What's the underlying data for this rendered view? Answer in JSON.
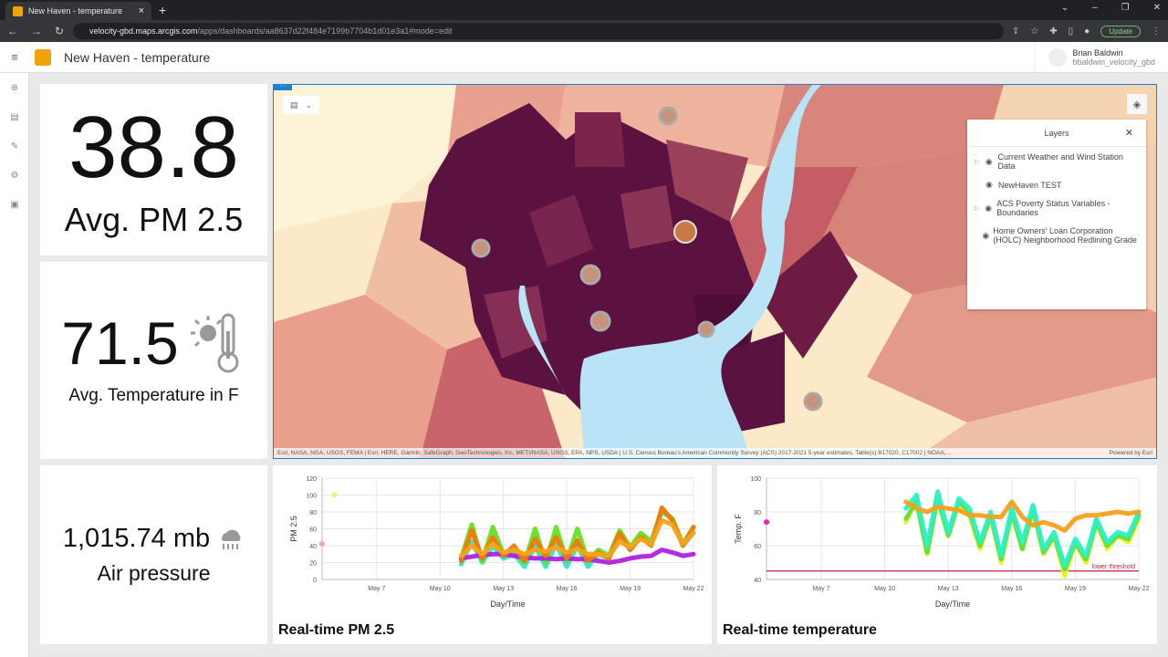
{
  "browser": {
    "tab_title": "New Haven - temperature",
    "url_host": "velocity-gbd.maps.arcgis.com",
    "url_path": "/apps/dashboards/aa8637d22f484e7199b7704b1d01e3a1#mode=edit",
    "update_label": "Update"
  },
  "app": {
    "title": "New Haven - temperature",
    "user_name": "Brian Baldwin",
    "user_handle": "bbaldwin_velocity_gbd"
  },
  "indicators": [
    {
      "value": "38.8",
      "label": "Avg. PM 2.5"
    },
    {
      "value": "71.5",
      "label": "Avg. Temperature in F",
      "icon": "sun-thermometer-icon"
    },
    {
      "value": "1,015.74 mb",
      "label": "Air pressure",
      "icon": "cloud-rain-icon"
    }
  ],
  "map": {
    "layers_title": "Layers",
    "layers": [
      {
        "label": "Current Weather and Wind Station Data",
        "expandable": true
      },
      {
        "label": "NewHaven TEST",
        "expandable": false
      },
      {
        "label": "ACS Poverty Status Variables - Boundaries",
        "expandable": true
      },
      {
        "label": "Home Owners' Loan Corporation (HOLC) Neighborhood Redlining Grade",
        "expandable": false
      }
    ],
    "attribution": "Esri, NASA, NGA, USGS, FEMA | Esri, HERE, Garmin, SafeGraph, GeoTechnologies, Inc, METI/NASA, USGS, EPA, NPS, USDA | U.S. Census Bureau's American Community Survey (ACS) 2017-2021 5-year estimates, Table(s) B17020, C17002 | NOAA,...",
    "powered_by": "Powered by Esri",
    "colors": {
      "water": "#b9e3f7",
      "darkest": "#54103a",
      "light": "#fbe9c8"
    }
  },
  "chart_data": [
    {
      "type": "line",
      "title": "Real-time PM 2.5",
      "xlabel": "Day/Time",
      "ylabel": "PM 2.5",
      "ylim": [
        0,
        120
      ],
      "yticks": [
        "0",
        "20",
        "40",
        "60",
        "80",
        "100",
        "120"
      ],
      "xlim": [
        "May 4 10:00",
        "May 22 00:00"
      ],
      "xticks": [
        "May 7",
        "May 10",
        "May 13",
        "May 16",
        "May 19",
        "May 22"
      ],
      "grid": true,
      "x": [
        "May 11 00:00",
        "May 11 12:00",
        "May 12 00:00",
        "May 12 12:00",
        "May 13 00:00",
        "May 13 12:00",
        "May 14 00:00",
        "May 14 12:00",
        "May 15 00:00",
        "May 15 12:00",
        "May 16 00:00",
        "May 16 12:00",
        "May 17 00:00",
        "May 17 12:00",
        "May 18 00:00",
        "May 18 12:00",
        "May 19 00:00",
        "May 19 12:00",
        "May 20 00:00",
        "May 20 12:00",
        "May 21 00:00",
        "May 21 12:00",
        "May 22 00:00"
      ],
      "series": [
        {
          "color": "#2ee6c8",
          "values": [
            18,
            45,
            20,
            40,
            25,
            30,
            15,
            40,
            15,
            42,
            15,
            40,
            15,
            30,
            25,
            52,
            35,
            50,
            45,
            80,
            72,
            40,
            55
          ]
        },
        {
          "color": "#66e020",
          "values": [
            25,
            65,
            22,
            62,
            30,
            35,
            20,
            60,
            20,
            62,
            22,
            60,
            22,
            35,
            28,
            58,
            38,
            55,
            45,
            82,
            72,
            42,
            62
          ]
        },
        {
          "color": "#b020e0",
          "values": [
            25,
            27,
            29,
            30,
            30,
            28,
            26,
            25,
            25,
            24,
            25,
            24,
            24,
            22,
            20,
            22,
            25,
            27,
            28,
            35,
            32,
            28,
            30
          ]
        },
        {
          "color": "#f0780a",
          "values": [
            22,
            58,
            25,
            50,
            28,
            40,
            22,
            48,
            28,
            50,
            25,
            46,
            22,
            32,
            25,
            55,
            35,
            50,
            40,
            85,
            70,
            40,
            62
          ]
        },
        {
          "color": "#f5a41a",
          "values": [
            28,
            40,
            30,
            42,
            32,
            35,
            30,
            35,
            33,
            38,
            32,
            36,
            30,
            30,
            28,
            45,
            38,
            48,
            42,
            70,
            65,
            42,
            55
          ]
        }
      ],
      "points": [
        {
          "x": "May 4 10:00",
          "y": 42,
          "color": "#e8a0d8"
        },
        {
          "x": "May 5 00:00",
          "y": 100,
          "color": "#f0f080"
        }
      ]
    },
    {
      "type": "line",
      "title": "Real-time temperature",
      "xlabel": "Day/Time",
      "ylabel": "Temp. F",
      "ylim": [
        40,
        100
      ],
      "yticks": [
        "40",
        "60",
        "80",
        "100"
      ],
      "xlim": [
        "May 4 10:00",
        "May 22 00:00"
      ],
      "xticks": [
        "May 7",
        "May 10",
        "May 13",
        "May 16",
        "May 19",
        "May 22"
      ],
      "grid": true,
      "x": [
        "May 11 00:00",
        "May 11 12:00",
        "May 12 00:00",
        "May 12 12:00",
        "May 13 00:00",
        "May 13 12:00",
        "May 14 00:00",
        "May 14 12:00",
        "May 15 00:00",
        "May 15 12:00",
        "May 16 00:00",
        "May 16 12:00",
        "May 17 00:00",
        "May 17 12:00",
        "May 18 00:00",
        "May 18 12:00",
        "May 19 00:00",
        "May 19 12:00",
        "May 20 00:00",
        "May 20 12:00",
        "May 21 00:00",
        "May 21 12:00",
        "May 22 00:00"
      ],
      "series": [
        {
          "color": "#f0f020",
          "values": [
            74,
            88,
            55,
            90,
            66,
            86,
            78,
            58,
            78,
            50,
            80,
            58,
            82,
            55,
            66,
            42,
            62,
            50,
            74,
            58,
            66,
            62,
            76
          ]
        },
        {
          "color": "#60e030",
          "values": [
            76,
            86,
            56,
            88,
            66,
            86,
            80,
            60,
            78,
            52,
            80,
            58,
            82,
            56,
            66,
            46,
            62,
            52,
            74,
            60,
            66,
            64,
            78
          ]
        },
        {
          "color": "#2ef0c8",
          "values": [
            82,
            90,
            60,
            92,
            68,
            88,
            82,
            62,
            80,
            54,
            82,
            62,
            84,
            58,
            68,
            48,
            64,
            54,
            76,
            62,
            68,
            66,
            80
          ]
        },
        {
          "color": "#f5a01a",
          "values": [
            86,
            82,
            80,
            83,
            82,
            81,
            78,
            78,
            77,
            77,
            86,
            77,
            72,
            74,
            72,
            69,
            76,
            78,
            78,
            79,
            80,
            79,
            80
          ]
        }
      ],
      "points": [
        {
          "x": "May 4 10:00",
          "y": 74,
          "color": "#f020c0"
        }
      ],
      "threshold": {
        "value": 45,
        "label": "lower threshold",
        "color": "#c81e3c"
      }
    }
  ]
}
